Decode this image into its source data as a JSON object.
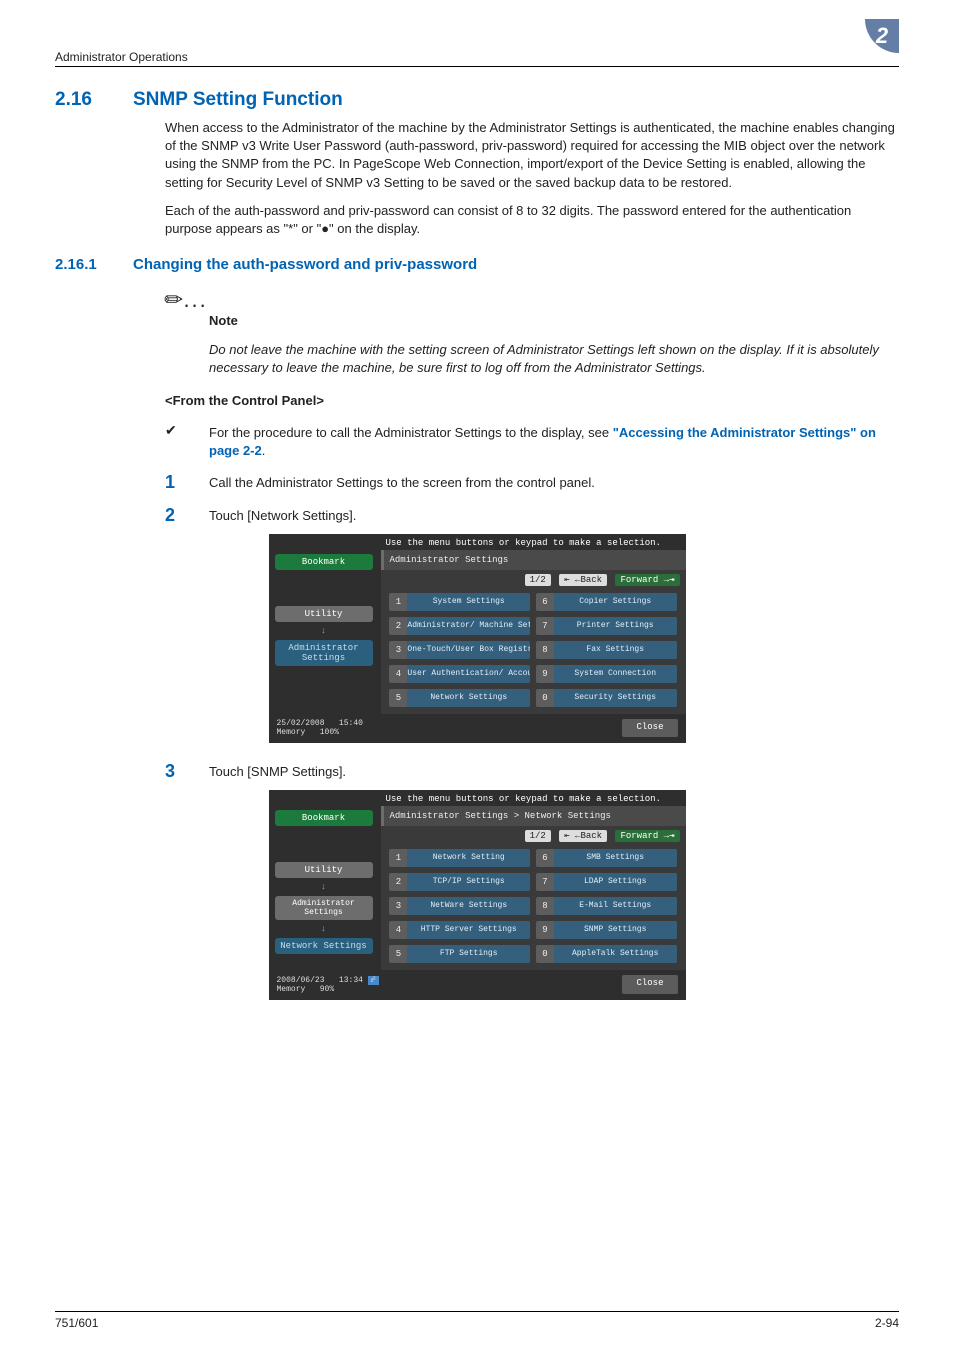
{
  "header": {
    "left": "Administrator Operations",
    "chapter": "2"
  },
  "section": {
    "num": "2.16",
    "title": "SNMP Setting Function"
  },
  "paragraphs": {
    "p1": "When access to the Administrator of the machine by the Administrator Settings is authenticated, the machine enables changing of the SNMP v3 Write User Password (auth-password, priv-password) required for accessing the MIB object over the network using the SNMP from the PC. In PageScope Web Connection, import/export of the Device Setting is enabled, allowing the setting for Security Level of SNMP v3 Setting to be saved or the saved backup data to be restored.",
    "p2": "Each of the auth-password and priv-password can consist of 8 to 32 digits. The password entered for the authentication purpose appears as \"*\" or \"●\" on the display."
  },
  "subsection": {
    "num": "2.16.1",
    "title": "Changing the auth-password and priv-password"
  },
  "note": {
    "label": "Note",
    "text": "Do not leave the machine with the setting screen of Administrator Settings left shown on the display. If it is absolutely necessary to leave the machine, be sure first to log off from the Administrator Settings."
  },
  "from_panel": "<From the Control Panel>",
  "bullet": {
    "pre": "For the procedure to call the Administrator Settings to the display, see ",
    "link": "\"Accessing the Administrator Settings\" on page 2-2",
    "post": "."
  },
  "steps": {
    "s1": "Call the Administrator Settings to the screen from the control panel.",
    "s2": "Touch [Network Settings].",
    "s3": "Touch [SNMP Settings]."
  },
  "screen1": {
    "instr": "Use the menu buttons or keypad to make a selection.",
    "bookmark": "Bookmark",
    "utility": "Utility",
    "admin": "Administrator Settings",
    "crumb": "Administrator Settings",
    "pager_page": "1/2",
    "pager_back": "⇤ ←Back",
    "pager_fwd": "Forward →⇥",
    "menu": [
      {
        "n": "1",
        "l": "System Settings"
      },
      {
        "n": "6",
        "l": "Copier Settings"
      },
      {
        "n": "2",
        "l": "Administrator/\nMachine Settings"
      },
      {
        "n": "7",
        "l": "Printer Settings"
      },
      {
        "n": "3",
        "l": "One-Touch/User Box\nRegistration"
      },
      {
        "n": "8",
        "l": "Fax Settings"
      },
      {
        "n": "4",
        "l": "User Authentication/\nAccount Track"
      },
      {
        "n": "9",
        "l": "System Connection"
      },
      {
        "n": "5",
        "l": "Network Settings"
      },
      {
        "n": "0",
        "l": "Security Settings"
      }
    ],
    "date": "25/02/2008",
    "time": "15:40",
    "mem_label": "Memory",
    "mem_val": "100%",
    "close": "Close"
  },
  "screen2": {
    "instr": "Use the menu buttons or keypad to make a selection.",
    "bookmark": "Bookmark",
    "utility": "Utility",
    "admin": "Administrator Settings",
    "network": "Network Settings",
    "crumb": "Administrator Settings > Network Settings",
    "pager_page": "1/2",
    "pager_back": "⇤ ←Back",
    "pager_fwd": "Forward →⇥",
    "menu": [
      {
        "n": "1",
        "l": "Network Setting"
      },
      {
        "n": "6",
        "l": "SMB Settings"
      },
      {
        "n": "2",
        "l": "TCP/IP Settings"
      },
      {
        "n": "7",
        "l": "LDAP Settings"
      },
      {
        "n": "3",
        "l": "NetWare Settings"
      },
      {
        "n": "8",
        "l": "E-Mail Settings"
      },
      {
        "n": "4",
        "l": "HTTP Server Settings"
      },
      {
        "n": "9",
        "l": "SNMP Settings"
      },
      {
        "n": "5",
        "l": "FTP Settings"
      },
      {
        "n": "0",
        "l": "AppleTalk Settings"
      }
    ],
    "date": "2008/06/23",
    "time": "13:34",
    "mem_label": "Memory",
    "mem_val": "90%",
    "close": "Close"
  },
  "footer": {
    "left": "751/601",
    "right": "2-94"
  }
}
